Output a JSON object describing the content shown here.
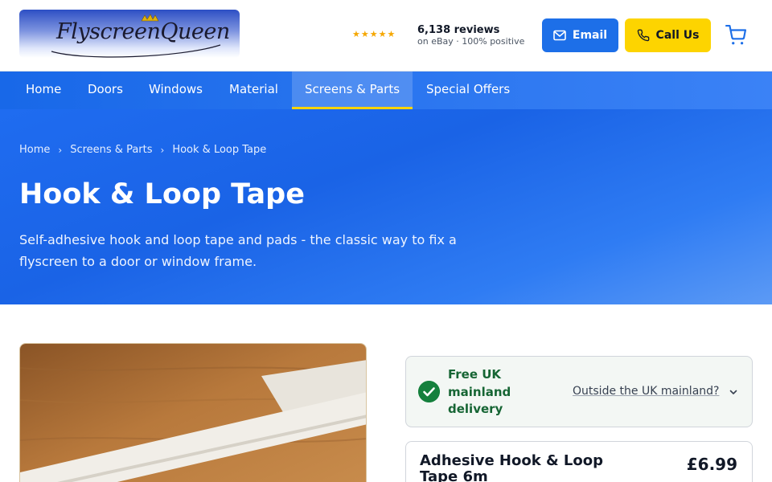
{
  "header": {
    "logo_text": "FlyscreenQueen",
    "rating": {
      "stars": "★★★★★",
      "count_label": "6,138 reviews",
      "source_label": "on eBay · 100% positive"
    },
    "email_label": "Email",
    "call_label": "Call Us",
    "cart_icon": "cart-icon"
  },
  "nav": {
    "items": [
      {
        "label": "Home"
      },
      {
        "label": "Doors"
      },
      {
        "label": "Windows"
      },
      {
        "label": "Material"
      },
      {
        "label": "Screens & Parts"
      },
      {
        "label": "Special Offers"
      }
    ],
    "active": "Screens & Parts"
  },
  "breadcrumb": {
    "items": [
      "Home",
      "Screens & Parts",
      "Hook & Loop Tape"
    ],
    "separator": "›"
  },
  "hero": {
    "title": "Hook & Loop Tape",
    "description": "Self-adhesive hook and loop tape and pads - the classic way to fix a flyscreen to a door or window frame."
  },
  "delivery": {
    "title": "Free UK mainland delivery",
    "outside_link": "Outside the UK mainland?"
  },
  "product": {
    "name": "Adhesive Hook & Loop Tape 6m",
    "price": "£6.99"
  },
  "colors": {
    "brand_blue": "#1d6fe8",
    "call_yellow": "#fdd400",
    "delivery_green": "#15803d"
  }
}
